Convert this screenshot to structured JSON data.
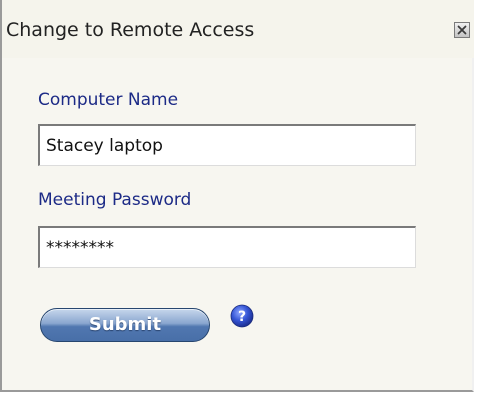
{
  "window": {
    "title": "Change to Remote Access"
  },
  "form": {
    "computer_name_label": "Computer Name",
    "computer_name_value": "Stacey laptop",
    "password_label": "Meeting Password",
    "password_value": "********",
    "submit_label": "Submit"
  },
  "icons": {
    "close": "close-icon",
    "help": "help-icon"
  },
  "colors": {
    "label_text": "#1c2a86",
    "submit_button": "#5177b0",
    "help_icon": "#2f4fc4"
  }
}
